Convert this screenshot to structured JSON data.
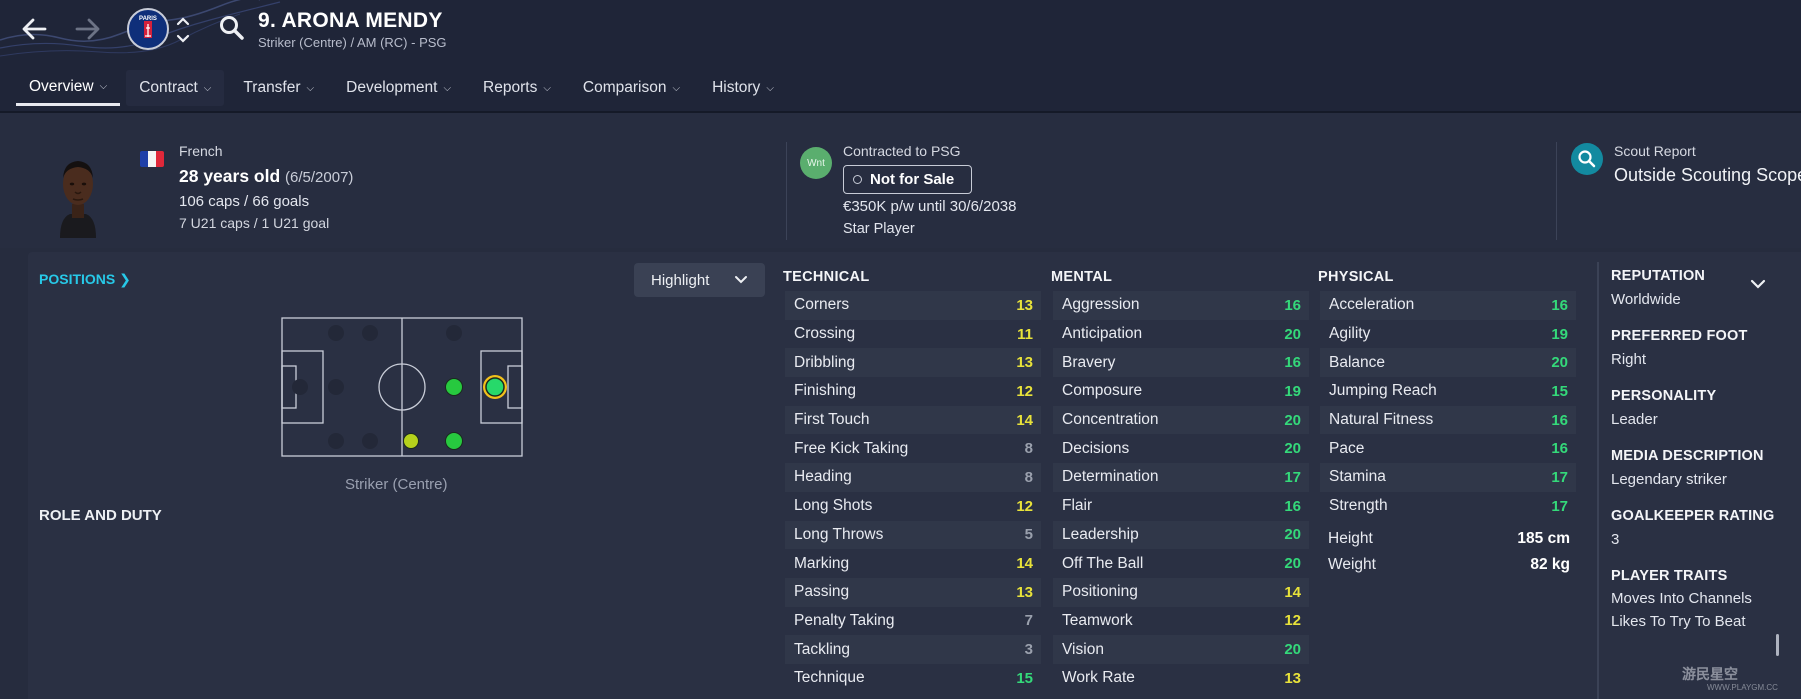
{
  "player": {
    "name": "9. ARONA MENDY",
    "role": "Striker (Centre) / AM (RC) - PSG",
    "nationality": "French",
    "age": "28 years old",
    "dob": "(6/5/2007)",
    "caps": "106 caps / 66 goals",
    "u21": "7 U21 caps / 1 U21 goal"
  },
  "crest_text": "PARIS",
  "tabs": [
    {
      "label": "Overview"
    },
    {
      "label": "Contract"
    },
    {
      "label": "Transfer"
    },
    {
      "label": "Development"
    },
    {
      "label": "Reports"
    },
    {
      "label": "Comparison"
    },
    {
      "label": "History"
    }
  ],
  "contract": {
    "badge": "Wnt",
    "contracted": "Contracted to PSG",
    "transfer_status": "Not for Sale",
    "wage": "€350K p/w until 30/6/2038",
    "squad_status": "Star Player"
  },
  "scout": {
    "label": "Scout Report",
    "value": "Outside Scouting Scope"
  },
  "positions_link": "POSITIONS",
  "highlight_label": "Highlight",
  "position_label": "Striker (Centre)",
  "role_and_duty": "ROLE AND DUTY",
  "colors": {
    "high": "#34d97a",
    "mid": "#e8e23a",
    "low": "#9aa0ad",
    "accent": "#27c9e8"
  },
  "technical": {
    "heading": "TECHNICAL",
    "attrs": [
      {
        "name": "Corners",
        "value": "13"
      },
      {
        "name": "Crossing",
        "value": "11"
      },
      {
        "name": "Dribbling",
        "value": "13"
      },
      {
        "name": "Finishing",
        "value": "12"
      },
      {
        "name": "First Touch",
        "value": "14"
      },
      {
        "name": "Free Kick Taking",
        "value": "8"
      },
      {
        "name": "Heading",
        "value": "8"
      },
      {
        "name": "Long Shots",
        "value": "12"
      },
      {
        "name": "Long Throws",
        "value": "5"
      },
      {
        "name": "Marking",
        "value": "14"
      },
      {
        "name": "Passing",
        "value": "13"
      },
      {
        "name": "Penalty Taking",
        "value": "7"
      },
      {
        "name": "Tackling",
        "value": "3"
      },
      {
        "name": "Technique",
        "value": "15"
      }
    ]
  },
  "mental": {
    "heading": "MENTAL",
    "attrs": [
      {
        "name": "Aggression",
        "value": "16"
      },
      {
        "name": "Anticipation",
        "value": "20"
      },
      {
        "name": "Bravery",
        "value": "16"
      },
      {
        "name": "Composure",
        "value": "19"
      },
      {
        "name": "Concentration",
        "value": "20"
      },
      {
        "name": "Decisions",
        "value": "20"
      },
      {
        "name": "Determination",
        "value": "17"
      },
      {
        "name": "Flair",
        "value": "16"
      },
      {
        "name": "Leadership",
        "value": "20"
      },
      {
        "name": "Off The Ball",
        "value": "20"
      },
      {
        "name": "Positioning",
        "value": "14"
      },
      {
        "name": "Teamwork",
        "value": "12"
      },
      {
        "name": "Vision",
        "value": "20"
      },
      {
        "name": "Work Rate",
        "value": "13"
      }
    ]
  },
  "physical": {
    "heading": "PHYSICAL",
    "attrs": [
      {
        "name": "Acceleration",
        "value": "16"
      },
      {
        "name": "Agility",
        "value": "19"
      },
      {
        "name": "Balance",
        "value": "20"
      },
      {
        "name": "Jumping Reach",
        "value": "15"
      },
      {
        "name": "Natural Fitness",
        "value": "16"
      },
      {
        "name": "Pace",
        "value": "16"
      },
      {
        "name": "Stamina",
        "value": "17"
      },
      {
        "name": "Strength",
        "value": "17"
      }
    ],
    "height_label": "Height",
    "height": "185 cm",
    "weight_label": "Weight",
    "weight": "82 kg"
  },
  "info": {
    "reputation_h": "REPUTATION",
    "reputation": "Worldwide",
    "foot_h": "PREFERRED FOOT",
    "foot": "Right",
    "personality_h": "PERSONALITY",
    "personality": "Leader",
    "media_h": "MEDIA DESCRIPTION",
    "media": "Legendary striker",
    "gk_h": "GOALKEEPER RATING",
    "gk": "3",
    "traits_h": "PLAYER TRAITS",
    "traits": [
      "Moves Into Channels",
      "Likes To Try To Beat"
    ]
  },
  "watermark": "游民星空",
  "watermark_url": "WWW.PLAYGM.CC"
}
